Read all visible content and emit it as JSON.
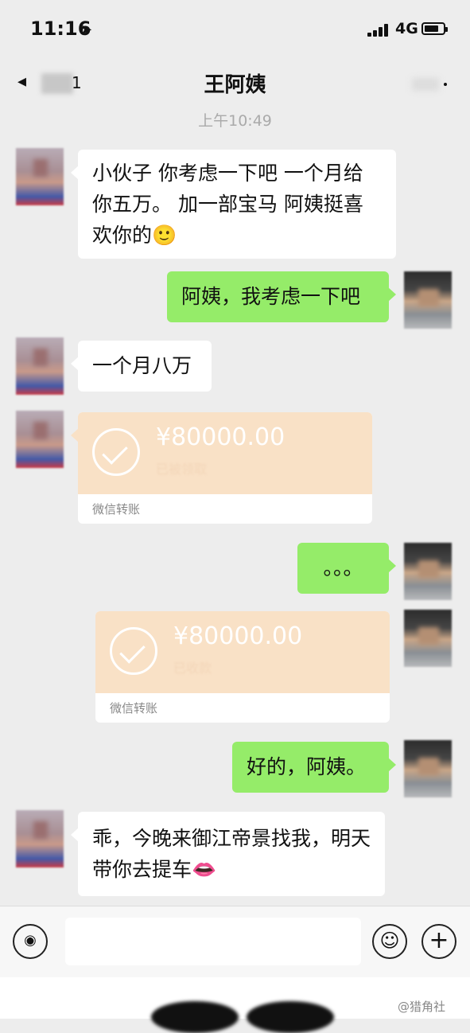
{
  "status_bar": {
    "time": "11:16",
    "location_icon": "location-arrow-icon",
    "network": "4G"
  },
  "nav": {
    "title": "王阿姨",
    "back_count": "1"
  },
  "timestamp": "上午10:49",
  "messages": {
    "m1": "小伙子 你考虑一下吧 一个月给你五万。 加一部宝马 阿姨挺喜欢你的🙂",
    "m2": "阿姨，我考虑一下吧",
    "m3": "一个月八万",
    "m5": "。。。",
    "m7": "好的，阿姨。",
    "m8": "乖，今晚来御江帝景找我，明天带你去提车👄"
  },
  "transfers": [
    {
      "amount": "¥80000.00",
      "status": "已被领取",
      "label": "微信转账"
    },
    {
      "amount": "¥80000.00",
      "status": "已收款",
      "label": "微信转账"
    }
  ],
  "input_bar": {
    "placeholder": ""
  },
  "watermark": "@猎角社"
}
